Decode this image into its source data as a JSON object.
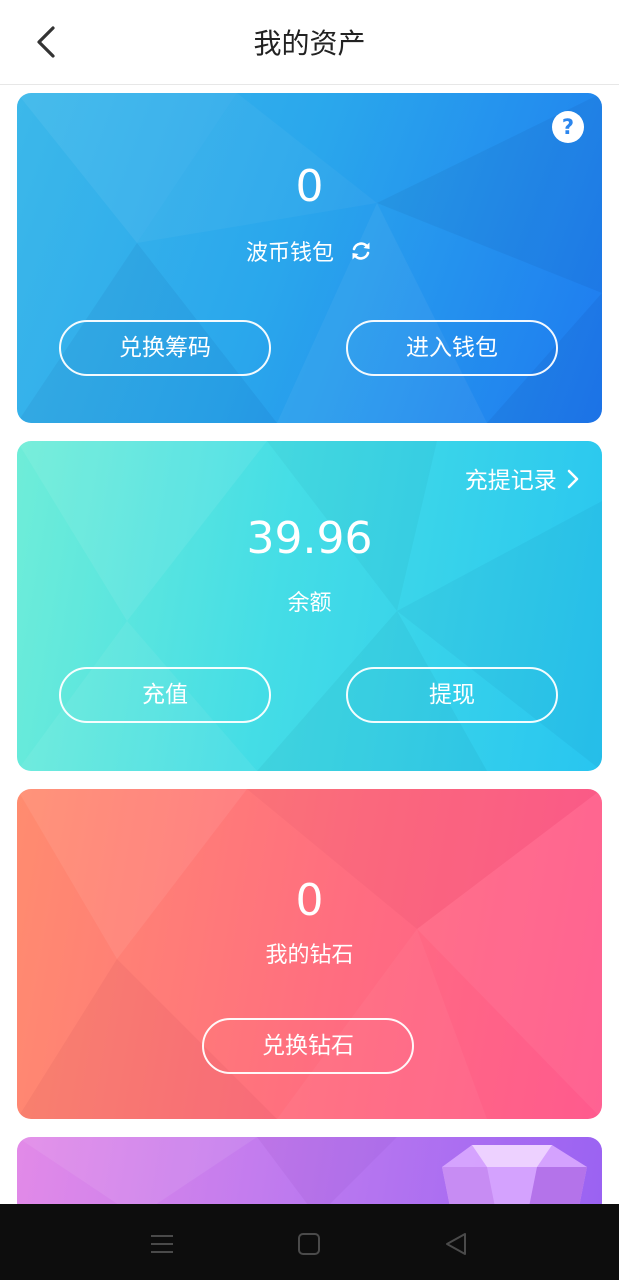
{
  "header": {
    "title": "我的资产",
    "back_icon": "chevron-left-icon"
  },
  "wallet_card": {
    "amount": "0",
    "label": "波币钱包",
    "refresh_icon": "refresh-icon",
    "help_icon": "question-icon",
    "help_symbol": "?",
    "buttons": {
      "exchange_chips": "兑换筹码",
      "enter_wallet": "进入钱包"
    },
    "color": "#2a9bee"
  },
  "balance_card": {
    "records_link": "充提记录",
    "records_chevron": "›",
    "amount": "39.96",
    "label": "余额",
    "buttons": {
      "recharge": "充值",
      "withdraw": "提现"
    },
    "color": "#3fd6e8"
  },
  "diamond_card": {
    "amount": "0",
    "label": "我的钻石",
    "buttons": {
      "exchange_diamonds": "兑换钻石"
    },
    "color": "#ff6a82"
  },
  "partial_card": {
    "color": "#b877f0",
    "icon": "gem-icon"
  },
  "navbar": {
    "menu_icon": "menu-icon",
    "home_icon": "square-home-icon",
    "back_icon": "triangle-back-icon"
  }
}
